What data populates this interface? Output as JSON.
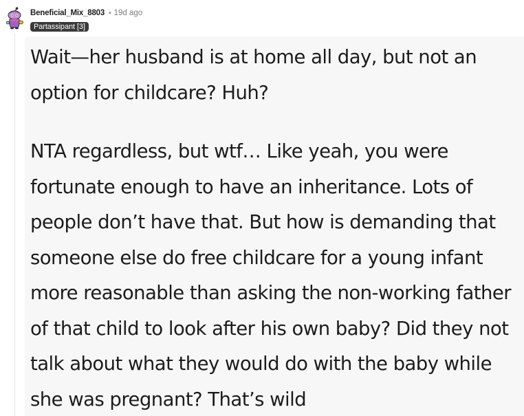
{
  "comment": {
    "author": "Beneficial_Mix_8803",
    "separator": "•",
    "age": "19d ago",
    "flair": "Partassipant [3]",
    "paragraphs": [
      "Wait—her husband is at home all day, but not an option for childcare? Huh?",
      "NTA regardless, but wtf… Like yeah, you were fortunate enough to have an inheritance. Lots of people don’t have that. But how is demanding that someone else do free childcare for a young infant more reasonable than asking the non-working father of that child to look after his own baby? Did they not talk about what they would do with the baby while she was pregnant? That’s wild"
    ]
  },
  "icons": {
    "avatar": "snoo-avatar-icon"
  },
  "colors": {
    "text": "#1c1c1c",
    "muted": "#7c7c7c",
    "flair_bg": "#3a3a3a",
    "body_bg": "#f7f7f7",
    "thread_line": "#e6e6e6"
  }
}
